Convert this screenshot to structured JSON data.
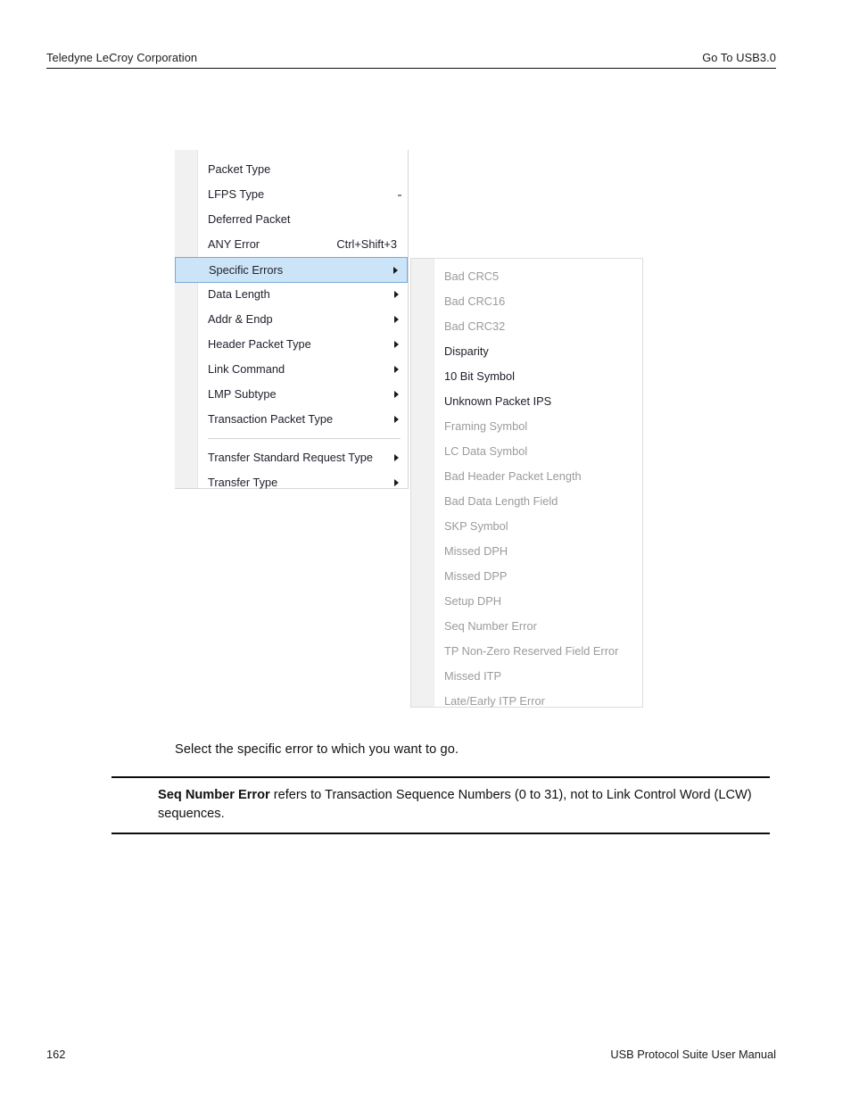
{
  "header": {
    "left": "Teledyne LeCroy Corporation",
    "right": "Go To USB3.0"
  },
  "footer": {
    "page_number": "162",
    "manual_title": "USB Protocol Suite User Manual"
  },
  "body": {
    "instruction": "Select the specific error to which you want to go."
  },
  "note": {
    "bold_lead": "Seq Number Error",
    "rest": " refers to Transaction Sequence Numbers (0 to 31), not to Link Control Word (LCW) sequences."
  },
  "colors": {
    "highlight_fill": "#cce4f8",
    "highlight_border": "#79a9d8",
    "menu_gutter": "#f1f1f1",
    "enabled_text": "#20202c",
    "disabled_text": "#9b9b9b"
  },
  "menu_primary": {
    "items": [
      {
        "label": "Packet Type",
        "shortcut": "",
        "submenu": false,
        "disabled": false,
        "highlighted": false
      },
      {
        "label": "LFPS Type",
        "shortcut": "",
        "submenu": false,
        "disabled": false,
        "highlighted": false
      },
      {
        "label": "Deferred Packet",
        "shortcut": "",
        "submenu": false,
        "disabled": false,
        "highlighted": false
      },
      {
        "label": "ANY Error",
        "shortcut": "Ctrl+Shift+3",
        "submenu": false,
        "disabled": false,
        "highlighted": false
      },
      {
        "label": "Specific Errors",
        "shortcut": "",
        "submenu": true,
        "disabled": false,
        "highlighted": true
      },
      {
        "label": "Data Length",
        "shortcut": "",
        "submenu": true,
        "disabled": false,
        "highlighted": false
      },
      {
        "label": "Addr & Endp",
        "shortcut": "",
        "submenu": true,
        "disabled": false,
        "highlighted": false
      },
      {
        "label": "Header Packet Type",
        "shortcut": "",
        "submenu": true,
        "disabled": false,
        "highlighted": false
      },
      {
        "label": "Link Command",
        "shortcut": "",
        "submenu": true,
        "disabled": false,
        "highlighted": false
      },
      {
        "label": "LMP Subtype",
        "shortcut": "",
        "submenu": true,
        "disabled": false,
        "highlighted": false
      },
      {
        "label": "Transaction Packet Type",
        "shortcut": "",
        "submenu": true,
        "disabled": false,
        "highlighted": false
      },
      {
        "separator": true
      },
      {
        "label": "Transfer Standard Request Type",
        "shortcut": "",
        "submenu": true,
        "disabled": false,
        "highlighted": false
      },
      {
        "label": "Transfer Type",
        "shortcut": "",
        "submenu": true,
        "disabled": false,
        "highlighted": false
      }
    ]
  },
  "menu_submenu": {
    "items": [
      {
        "label": "Bad CRC5",
        "disabled": true
      },
      {
        "label": "Bad CRC16",
        "disabled": true
      },
      {
        "label": "Bad CRC32",
        "disabled": true
      },
      {
        "label": "Disparity",
        "disabled": false
      },
      {
        "label": "10 Bit Symbol",
        "disabled": false
      },
      {
        "label": "Unknown Packet IPS",
        "disabled": false
      },
      {
        "label": "Framing Symbol",
        "disabled": true
      },
      {
        "label": "LC Data Symbol",
        "disabled": true
      },
      {
        "label": "Bad Header Packet Length",
        "disabled": true
      },
      {
        "label": "Bad Data Length Field",
        "disabled": true
      },
      {
        "label": "SKP Symbol",
        "disabled": true
      },
      {
        "label": "Missed DPH",
        "disabled": true
      },
      {
        "label": "Missed DPP",
        "disabled": true
      },
      {
        "label": "Setup DPH",
        "disabled": true
      },
      {
        "label": "Seq Number Error",
        "disabled": true
      },
      {
        "label": "TP Non-Zero Reserved Field Error",
        "disabled": true
      },
      {
        "label": "Missed ITP",
        "disabled": true
      },
      {
        "label": "Late/Early ITP Error",
        "disabled": true
      }
    ]
  }
}
